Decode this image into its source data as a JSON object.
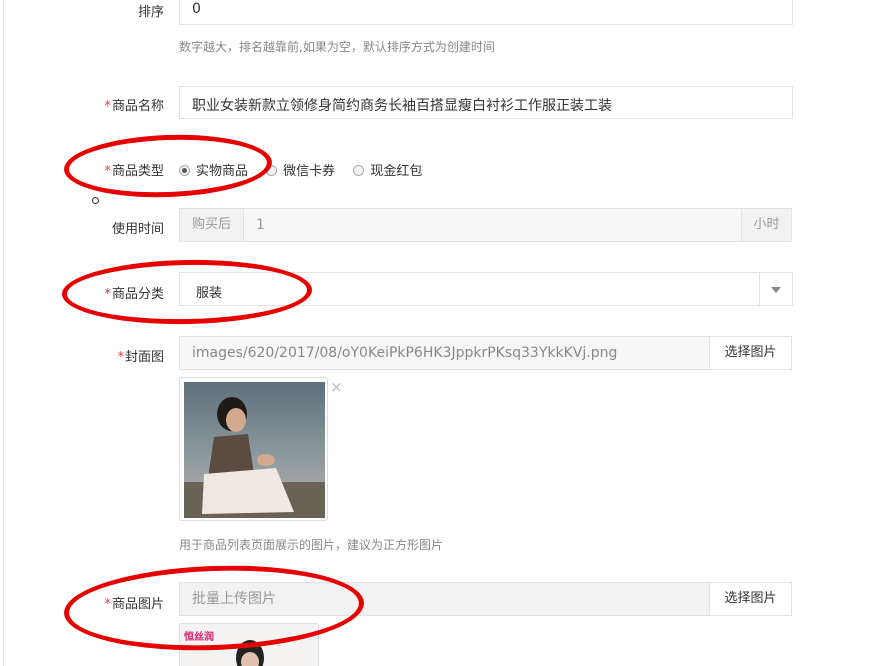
{
  "sort": {
    "label": "排序",
    "value": "0",
    "hint": "数字越大，排名越靠前,如果为空，默认排序方式为创建时间"
  },
  "name": {
    "required_mark": "*",
    "label": "商品名称",
    "value": "职业女装新款立领修身简约商务长袖百搭显瘦白衬衫工作服正装工装"
  },
  "type": {
    "required_mark": "*",
    "label": "商品类型",
    "options": [
      {
        "label": "实物商品",
        "checked": true
      },
      {
        "label": "微信卡券",
        "checked": false
      },
      {
        "label": "现金红包",
        "checked": false
      }
    ]
  },
  "use_time": {
    "label": "使用时间",
    "prefix": "购买后",
    "value": "1",
    "suffix": "小时"
  },
  "category": {
    "required_mark": "*",
    "label": "商品分类",
    "value": "服装"
  },
  "cover": {
    "required_mark": "*",
    "label": "封面图",
    "path": "images/620/2017/08/oY0KeiPkP6HK3JppkrPKsq33YkkKVj.png",
    "button": "选择图片",
    "remove": "×",
    "hint": "用于商品列表页面展示的图片，建议为正方形图片"
  },
  "images": {
    "required_mark": "*",
    "label": "商品图片",
    "placeholder": "批量上传图片",
    "button": "选择图片",
    "thumb_logo": "恒丝润"
  },
  "colors": {
    "annotation": "#e60000",
    "required": "#e4393c"
  }
}
